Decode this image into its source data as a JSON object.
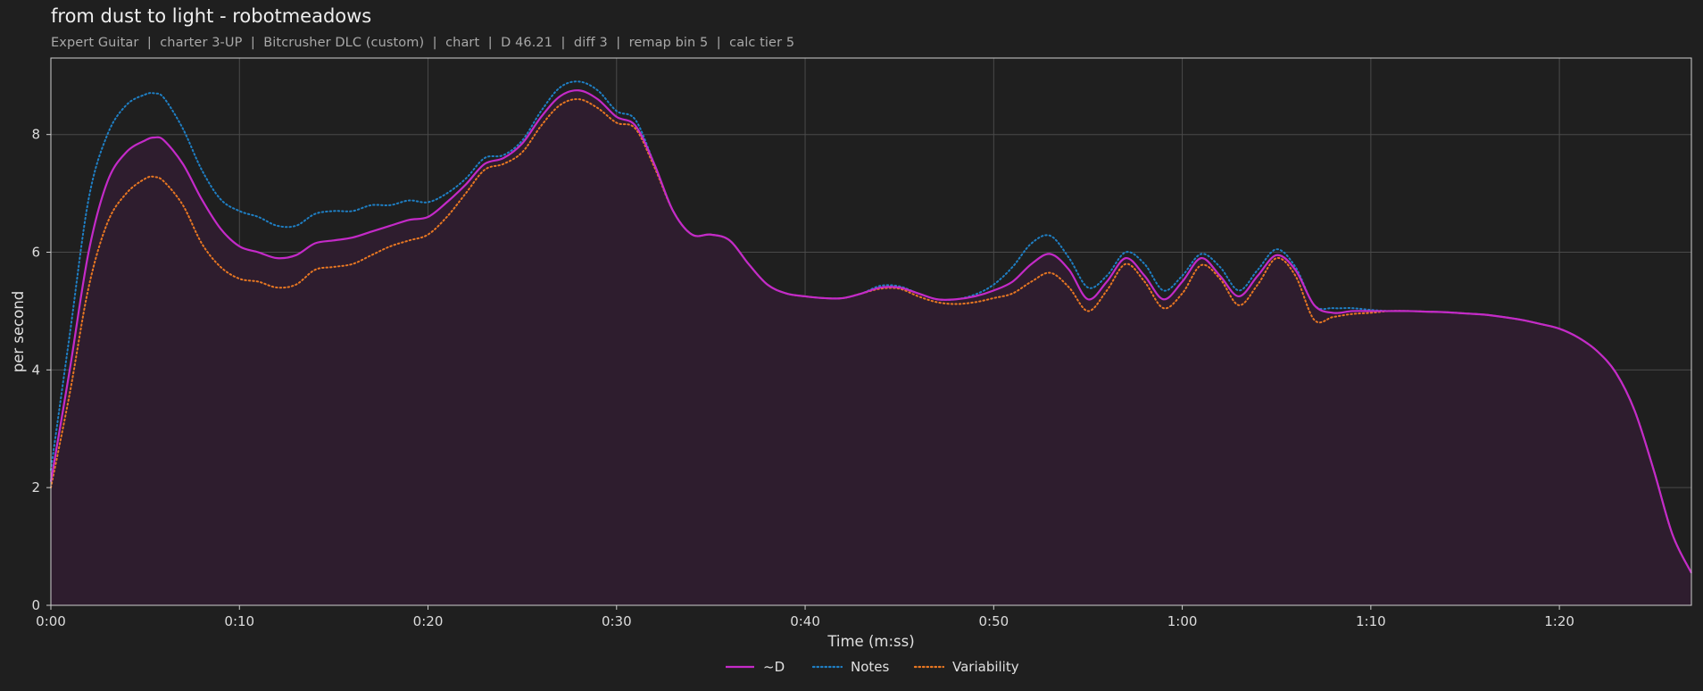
{
  "header": {
    "title": "from dust to light - robotmeadows",
    "subtitle": "Expert Guitar  |  charter 3-UP  |  Bitcrusher DLC (custom)  |  chart  |  D 46.21  |  diff 3  |  remap bin 5  |  calc tier 5"
  },
  "chart_data": {
    "type": "line",
    "title": "from dust to light - robotmeadows",
    "xlabel": "Time (m:ss)",
    "ylabel": "per second",
    "xlim": [
      0,
      87
    ],
    "ylim": [
      0,
      9.3
    ],
    "xticks": [
      0,
      10,
      20,
      30,
      40,
      50,
      60,
      70,
      80
    ],
    "xtick_labels": [
      "0:00",
      "0:10",
      "0:20",
      "0:30",
      "0:40",
      "0:50",
      "1:00",
      "1:10",
      "1:20"
    ],
    "yticks": [
      0,
      2,
      4,
      6,
      8
    ],
    "ytick_labels": [
      "0",
      "2",
      "4",
      "6",
      "8"
    ],
    "grid": true,
    "legend_position": "bottom-center",
    "series": [
      {
        "name": "~D",
        "color": "#c42ac8",
        "style": "solid",
        "filled": true,
        "fill_color": "#2e1d2e",
        "x": [
          0,
          1,
          2,
          3,
          4,
          5,
          5.5,
          6,
          7,
          8,
          9,
          10,
          11,
          12,
          13,
          14,
          15,
          16,
          17,
          18,
          19,
          20,
          21,
          22,
          23,
          24,
          25,
          26,
          27,
          28,
          29,
          30,
          31,
          32,
          33,
          34,
          35,
          36,
          37,
          38,
          39,
          40,
          41,
          42,
          43,
          44,
          45,
          46,
          47,
          48,
          49,
          50,
          51,
          52,
          53,
          54,
          55,
          56,
          57,
          58,
          59,
          60,
          61,
          62,
          63,
          64,
          65,
          66,
          67,
          68,
          69,
          70,
          71,
          72,
          73,
          74,
          75,
          76,
          77,
          78,
          79,
          80,
          81,
          82,
          83,
          84,
          85,
          86,
          87
        ],
        "y": [
          2.1,
          4.0,
          6.0,
          7.2,
          7.7,
          7.9,
          7.95,
          7.9,
          7.5,
          6.9,
          6.4,
          6.1,
          6.0,
          5.9,
          5.95,
          6.15,
          6.2,
          6.25,
          6.35,
          6.45,
          6.55,
          6.6,
          6.85,
          7.15,
          7.5,
          7.6,
          7.85,
          8.3,
          8.65,
          8.75,
          8.6,
          8.3,
          8.15,
          7.5,
          6.7,
          6.3,
          6.3,
          6.2,
          5.8,
          5.45,
          5.3,
          5.25,
          5.22,
          5.22,
          5.3,
          5.4,
          5.4,
          5.3,
          5.2,
          5.2,
          5.25,
          5.35,
          5.5,
          5.8,
          5.97,
          5.7,
          5.2,
          5.5,
          5.9,
          5.6,
          5.2,
          5.5,
          5.9,
          5.6,
          5.25,
          5.6,
          5.95,
          5.7,
          5.1,
          4.97,
          5.0,
          5.0,
          5.0,
          5.0,
          4.99,
          4.98,
          4.96,
          4.94,
          4.9,
          4.85,
          4.78,
          4.7,
          4.55,
          4.32,
          3.95,
          3.3,
          2.3,
          1.2,
          0.55
        ]
      },
      {
        "name": "Notes",
        "color": "#1f7fc4",
        "style": "dotted",
        "x": [
          0,
          1,
          2,
          3,
          4,
          5,
          5.5,
          6,
          7,
          8,
          9,
          10,
          11,
          12,
          13,
          14,
          15,
          16,
          17,
          18,
          19,
          20,
          21,
          22,
          23,
          24,
          25,
          26,
          27,
          28,
          29,
          30,
          31,
          32,
          33,
          34,
          35,
          36,
          37,
          38,
          39,
          40,
          41,
          42,
          43,
          44,
          45,
          46,
          47,
          48,
          49,
          50,
          51,
          52,
          53,
          54,
          55,
          56,
          57,
          58,
          59,
          60,
          61,
          62,
          63,
          64,
          65,
          66,
          67,
          68,
          69,
          70,
          71,
          72,
          73,
          74,
          75,
          76,
          77,
          78,
          79,
          80,
          81,
          82,
          83,
          84,
          85,
          86,
          87
        ],
        "y": [
          2.3,
          4.6,
          6.9,
          8.0,
          8.5,
          8.68,
          8.7,
          8.62,
          8.1,
          7.4,
          6.9,
          6.7,
          6.6,
          6.45,
          6.45,
          6.65,
          6.7,
          6.7,
          6.8,
          6.8,
          6.88,
          6.85,
          7.0,
          7.25,
          7.6,
          7.65,
          7.9,
          8.4,
          8.8,
          8.9,
          8.75,
          8.4,
          8.25,
          7.5,
          6.7,
          6.3,
          6.3,
          6.2,
          5.8,
          5.45,
          5.3,
          5.25,
          5.22,
          5.22,
          5.3,
          5.43,
          5.42,
          5.3,
          5.2,
          5.2,
          5.28,
          5.45,
          5.75,
          6.15,
          6.28,
          5.9,
          5.4,
          5.6,
          6.0,
          5.8,
          5.35,
          5.6,
          5.97,
          5.75,
          5.35,
          5.7,
          6.05,
          5.75,
          5.1,
          5.05,
          5.05,
          5.02,
          5.0,
          5.0,
          4.99,
          4.98,
          4.96,
          4.94,
          4.9,
          4.85,
          4.78,
          4.7,
          4.55,
          4.32,
          3.95,
          3.3,
          2.3,
          1.2,
          0.55
        ]
      },
      {
        "name": "Variability",
        "color": "#e87722",
        "style": "dotted",
        "x": [
          0,
          1,
          2,
          3,
          4,
          5,
          5.5,
          6,
          7,
          8,
          9,
          10,
          11,
          12,
          13,
          14,
          15,
          16,
          17,
          18,
          19,
          20,
          21,
          22,
          23,
          24,
          25,
          26,
          27,
          28,
          29,
          30,
          31,
          32,
          33,
          34,
          35,
          36,
          37,
          38,
          39,
          40,
          41,
          42,
          43,
          44,
          45,
          46,
          47,
          48,
          49,
          50,
          51,
          52,
          53,
          54,
          55,
          56,
          57,
          58,
          59,
          60,
          61,
          62,
          63,
          64,
          65,
          66,
          67,
          68,
          69,
          70,
          71,
          72,
          73,
          74,
          75,
          76,
          77,
          78,
          79,
          80,
          81,
          82,
          83,
          84,
          85,
          86,
          87
        ],
        "y": [
          2.0,
          3.6,
          5.4,
          6.5,
          7.0,
          7.25,
          7.28,
          7.2,
          6.8,
          6.15,
          5.75,
          5.55,
          5.5,
          5.4,
          5.45,
          5.7,
          5.75,
          5.8,
          5.95,
          6.1,
          6.2,
          6.3,
          6.6,
          7.0,
          7.4,
          7.5,
          7.7,
          8.15,
          8.5,
          8.6,
          8.45,
          8.2,
          8.1,
          7.45,
          6.7,
          6.3,
          6.3,
          6.2,
          5.8,
          5.45,
          5.3,
          5.25,
          5.22,
          5.22,
          5.3,
          5.38,
          5.38,
          5.25,
          5.15,
          5.12,
          5.15,
          5.22,
          5.3,
          5.5,
          5.65,
          5.4,
          5.0,
          5.35,
          5.8,
          5.5,
          5.05,
          5.3,
          5.78,
          5.55,
          5.1,
          5.45,
          5.9,
          5.6,
          4.85,
          4.9,
          4.95,
          4.97,
          5.0,
          5.0,
          4.99,
          4.98,
          4.96,
          4.94,
          4.9,
          4.85,
          4.78,
          4.7,
          4.55,
          4.32,
          3.95,
          3.3,
          2.3,
          1.2,
          0.55
        ]
      }
    ]
  }
}
